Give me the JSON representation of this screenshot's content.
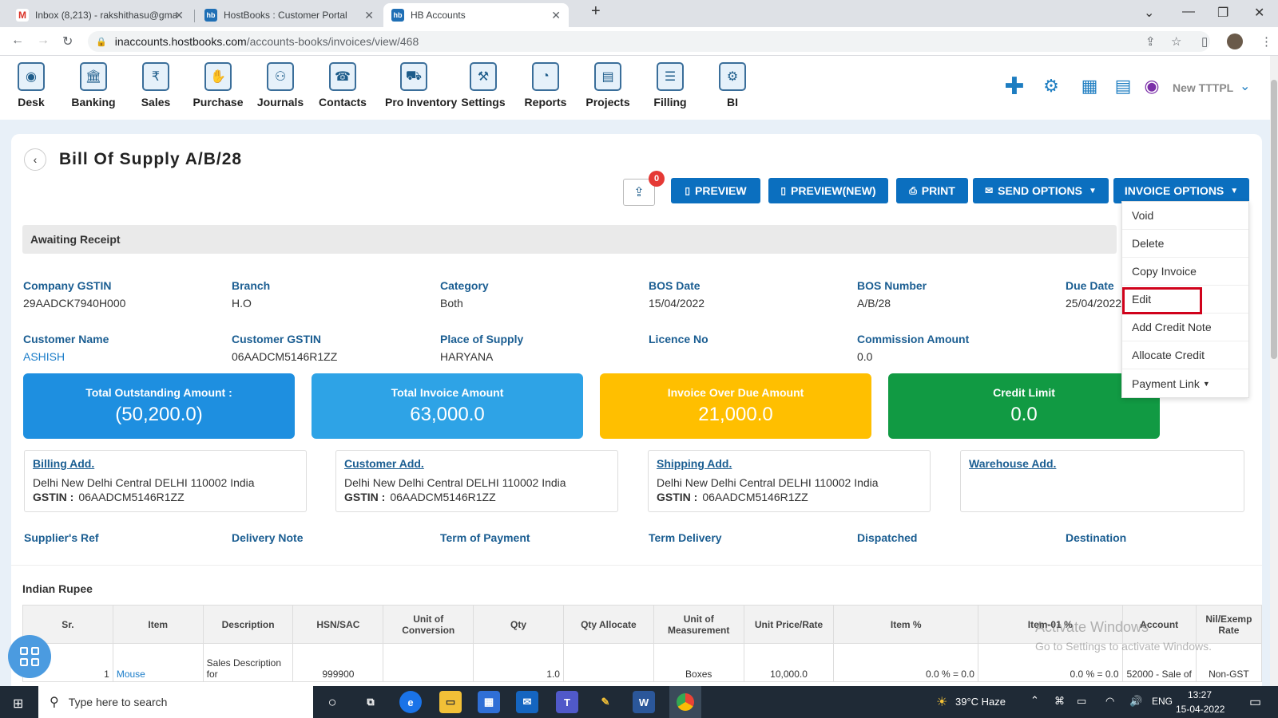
{
  "browser": {
    "tabs": [
      {
        "label": "Inbox (8,213) - rakshithasu@gma",
        "icon": "gmail-icon"
      },
      {
        "label": "HostBooks : Customer Portal",
        "icon": "hostbooks-icon"
      },
      {
        "label": "HB Accounts",
        "icon": "hostbooks-icon"
      }
    ],
    "url_domain": "inaccounts.hostbooks.com",
    "url_path": "/accounts-books/invoices/view/468"
  },
  "nav": {
    "items": [
      "Desk",
      "Banking",
      "Sales",
      "Purchase",
      "Journals",
      "Contacts",
      "Pro Inventory",
      "Settings",
      "Reports",
      "Projects",
      "Filling",
      "BI"
    ],
    "company": "New TTTPL"
  },
  "page": {
    "title": "Bill Of Supply A/B/28",
    "attach_count": "0",
    "buttons": {
      "preview": "PREVIEW",
      "preview_new": "PREVIEW(NEW)",
      "print": "PRINT",
      "send_options": "SEND OPTIONS",
      "invoice_options": "INVOICE OPTIONS"
    },
    "status": "Awaiting Receipt"
  },
  "fields": {
    "company_gstin": {
      "label": "Company GSTIN",
      "value": "29AADCK7940H000"
    },
    "branch": {
      "label": "Branch",
      "value": "H.O"
    },
    "category": {
      "label": "Category",
      "value": "Both"
    },
    "bos_date": {
      "label": "BOS Date",
      "value": "15/04/2022"
    },
    "bos_number": {
      "label": "BOS Number",
      "value": "A/B/28"
    },
    "due_date": {
      "label": "Due Date",
      "value": "25/04/2022"
    },
    "customer_name": {
      "label": "Customer Name",
      "value": "ASHISH"
    },
    "customer_gstin": {
      "label": "Customer GSTIN",
      "value": "06AADCM5146R1ZZ"
    },
    "place_of_supply": {
      "label": "Place of Supply",
      "value": "HARYANA"
    },
    "licence_no": {
      "label": "Licence No",
      "value": ""
    },
    "commission_amount": {
      "label": "Commission Amount",
      "value": "0.0"
    }
  },
  "kpis": [
    {
      "label": "Total Outstanding Amount :",
      "value": "(50,200.0)",
      "color": "#1e8fe0"
    },
    {
      "label": "Total Invoice Amount",
      "value": "63,000.0",
      "color": "#2ea3e6"
    },
    {
      "label": "Invoice Over Due Amount",
      "value": "21,000.0",
      "color": "#ffbf00"
    },
    {
      "label": "Credit Limit",
      "value": "0.0",
      "color": "#119a43"
    }
  ],
  "addresses": {
    "billing": {
      "label": "Billing Add.",
      "address": "Delhi New Delhi Central DELHI 110002 India",
      "gstin_label": "GSTIN :",
      "gstin": "06AADCM5146R1ZZ"
    },
    "customer": {
      "label": "Customer Add.",
      "address": "Delhi New Delhi Central DELHI 110002 India",
      "gstin_label": "GSTIN :",
      "gstin": "06AADCM5146R1ZZ"
    },
    "shipping": {
      "label": "Shipping Add.",
      "address": "Delhi New Delhi Central DELHI 110002 India",
      "gstin_label": "GSTIN :",
      "gstin": "06AADCM5146R1ZZ"
    },
    "warehouse": {
      "label": "Warehouse Add."
    }
  },
  "refs": [
    "Supplier's Ref",
    "Delivery Note",
    "Term of Payment",
    "Term Delivery",
    "Dispatched",
    "Destination"
  ],
  "currency": "Indian Rupee",
  "table": {
    "headers": [
      "Sr.",
      "Item",
      "Description",
      "HSN/SAC",
      "Unit of Conversion",
      "Qty",
      "Qty Allocate",
      "Unit of Measurement",
      "Unit Price/Rate",
      "Item %",
      "Item-01 %",
      "Account",
      "Nil/Exemp Rate"
    ],
    "row": [
      "1",
      "Mouse",
      "Sales Description for",
      "999900",
      "",
      "1.0",
      "",
      "Boxes",
      "10,000.0",
      "0.0 % = 0.0",
      "0.0 % = 0.0",
      "52000 - Sale of",
      "Non-GST"
    ]
  },
  "dropdown": {
    "items": [
      "Void",
      "Delete",
      "Copy Invoice",
      "Edit",
      "Add Credit Note",
      "Allocate Credit",
      "Payment Link"
    ]
  },
  "watermark": {
    "line1": "Activate Windows",
    "line2": "Go to Settings to activate Windows."
  },
  "taskbar": {
    "search_placeholder": "Type here to search",
    "weather": "39°C  Haze",
    "lang": "ENG",
    "time": "13:27",
    "date": "15-04-2022"
  }
}
